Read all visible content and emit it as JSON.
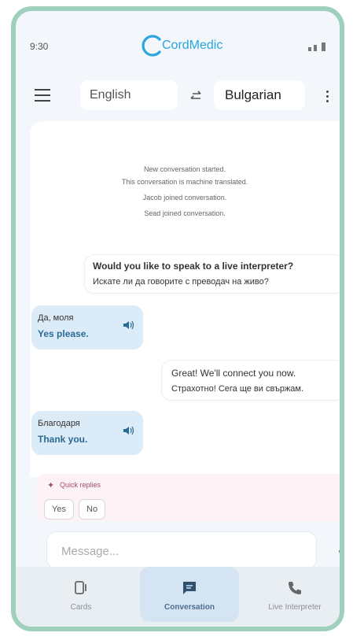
{
  "status": {
    "time": "9:30",
    "app_name": "CordMedic"
  },
  "toolbar": {
    "source_language": "English",
    "target_language": "Bulgarian"
  },
  "system_messages": [
    "New conversation started.",
    "This conversation is machine translated.",
    "Jacob joined conversation.",
    "Sead joined conversation."
  ],
  "messages": [
    {
      "side": "right",
      "primary": "Would you like to speak to a live interpreter?",
      "secondary": "Искате ли да говорите с преводач на живо?"
    },
    {
      "side": "left",
      "original": "Да, моля",
      "translation": "Yes please."
    },
    {
      "side": "right",
      "primary": "Great! We'll connect you now.",
      "secondary": "Страхотно! Сега ще ви свържам."
    },
    {
      "side": "left",
      "original": "Благодаря",
      "translation": "Thank you."
    }
  ],
  "quick_replies": {
    "title": "Quick replies",
    "options": [
      "Yes",
      "No"
    ]
  },
  "composer": {
    "placeholder": "Message..."
  },
  "bottom_nav": [
    {
      "label": "Cards",
      "icon": "cards-icon"
    },
    {
      "label": "Conversation",
      "icon": "chat-icon",
      "active": true
    },
    {
      "label": "Live Interpreter",
      "icon": "phone-icon"
    }
  ],
  "colors": {
    "accent": "#29a6de",
    "frame": "#9fd0bc",
    "incoming_bubble": "#dcebf8",
    "quick_reply_bg": "#fdf3f6"
  }
}
